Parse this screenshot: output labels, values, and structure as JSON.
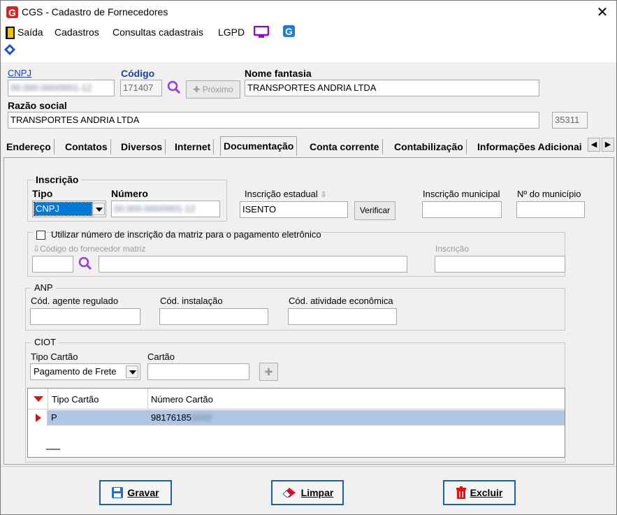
{
  "window": {
    "title": "CGS - Cadastro de Fornecedores",
    "close": "✕"
  },
  "menu": {
    "items": [
      "Saída",
      "Cadastros",
      "Consultas cadastrais",
      "LGPD"
    ]
  },
  "header": {
    "cnpj_label": "CNPJ",
    "cnpj_value": "00.000.000/0001-12",
    "codigo_label": "Código",
    "codigo_value": "171407",
    "proximo_label": "Próximo",
    "nome_fantasia_label": "Nome fantasia",
    "nome_fantasia_value": "TRANSPORTES ANDRIA LTDA",
    "razao_social_label": "Razão social",
    "razao_social_value": "TRANSPORTES ANDRIA LTDA",
    "razao_code": "35311"
  },
  "tabs": [
    "Endereço",
    "Contatos",
    "Diversos",
    "Internet",
    "Documentação",
    "Conta corrente",
    "Contabilização",
    "Informações Adicionai"
  ],
  "active_tab": "Documentação",
  "inscricao": {
    "group_label": "Inscrição",
    "tipo_label": "Tipo",
    "tipo_value": "CNPJ",
    "numero_label": "Número",
    "numero_value": "00.000.000/0001-12",
    "estadual_label": "Inscrição estadual",
    "estadual_value": "ISENTO",
    "verificar_label": "Verificar",
    "municipal_label": "Inscrição municipal",
    "municipio_label": "Nº do município"
  },
  "matriz": {
    "checkbox_label": "Utilizar número de inscrição da matriz para o pagamento eletrônico",
    "codigo_label": "Código do fornecedor matriz",
    "inscricao_label": "Inscrição"
  },
  "anp": {
    "group_label": "ANP",
    "agente_label": "Cód. agente regulado",
    "instalacao_label": "Cód. instalação",
    "atividade_label": "Cód. atividade econômica"
  },
  "ciot": {
    "group_label": "CIOT",
    "tipo_label": "Tipo Cartão",
    "tipo_value": "Pagamento de Frete",
    "cartao_label": "Cartão",
    "grid_headers": [
      "Tipo Cartão",
      "Número Cartão"
    ],
    "rows": [
      {
        "tipo": "P",
        "numero": "98176185",
        "numero_hidden": "0000"
      }
    ]
  },
  "buttons": {
    "gravar": "Gravar",
    "limpar": "Limpar",
    "excluir": "Excluir"
  },
  "colors": {
    "accent": "#1f5fa8",
    "selection": "#aec6e4",
    "link": "#1a3fb0"
  }
}
